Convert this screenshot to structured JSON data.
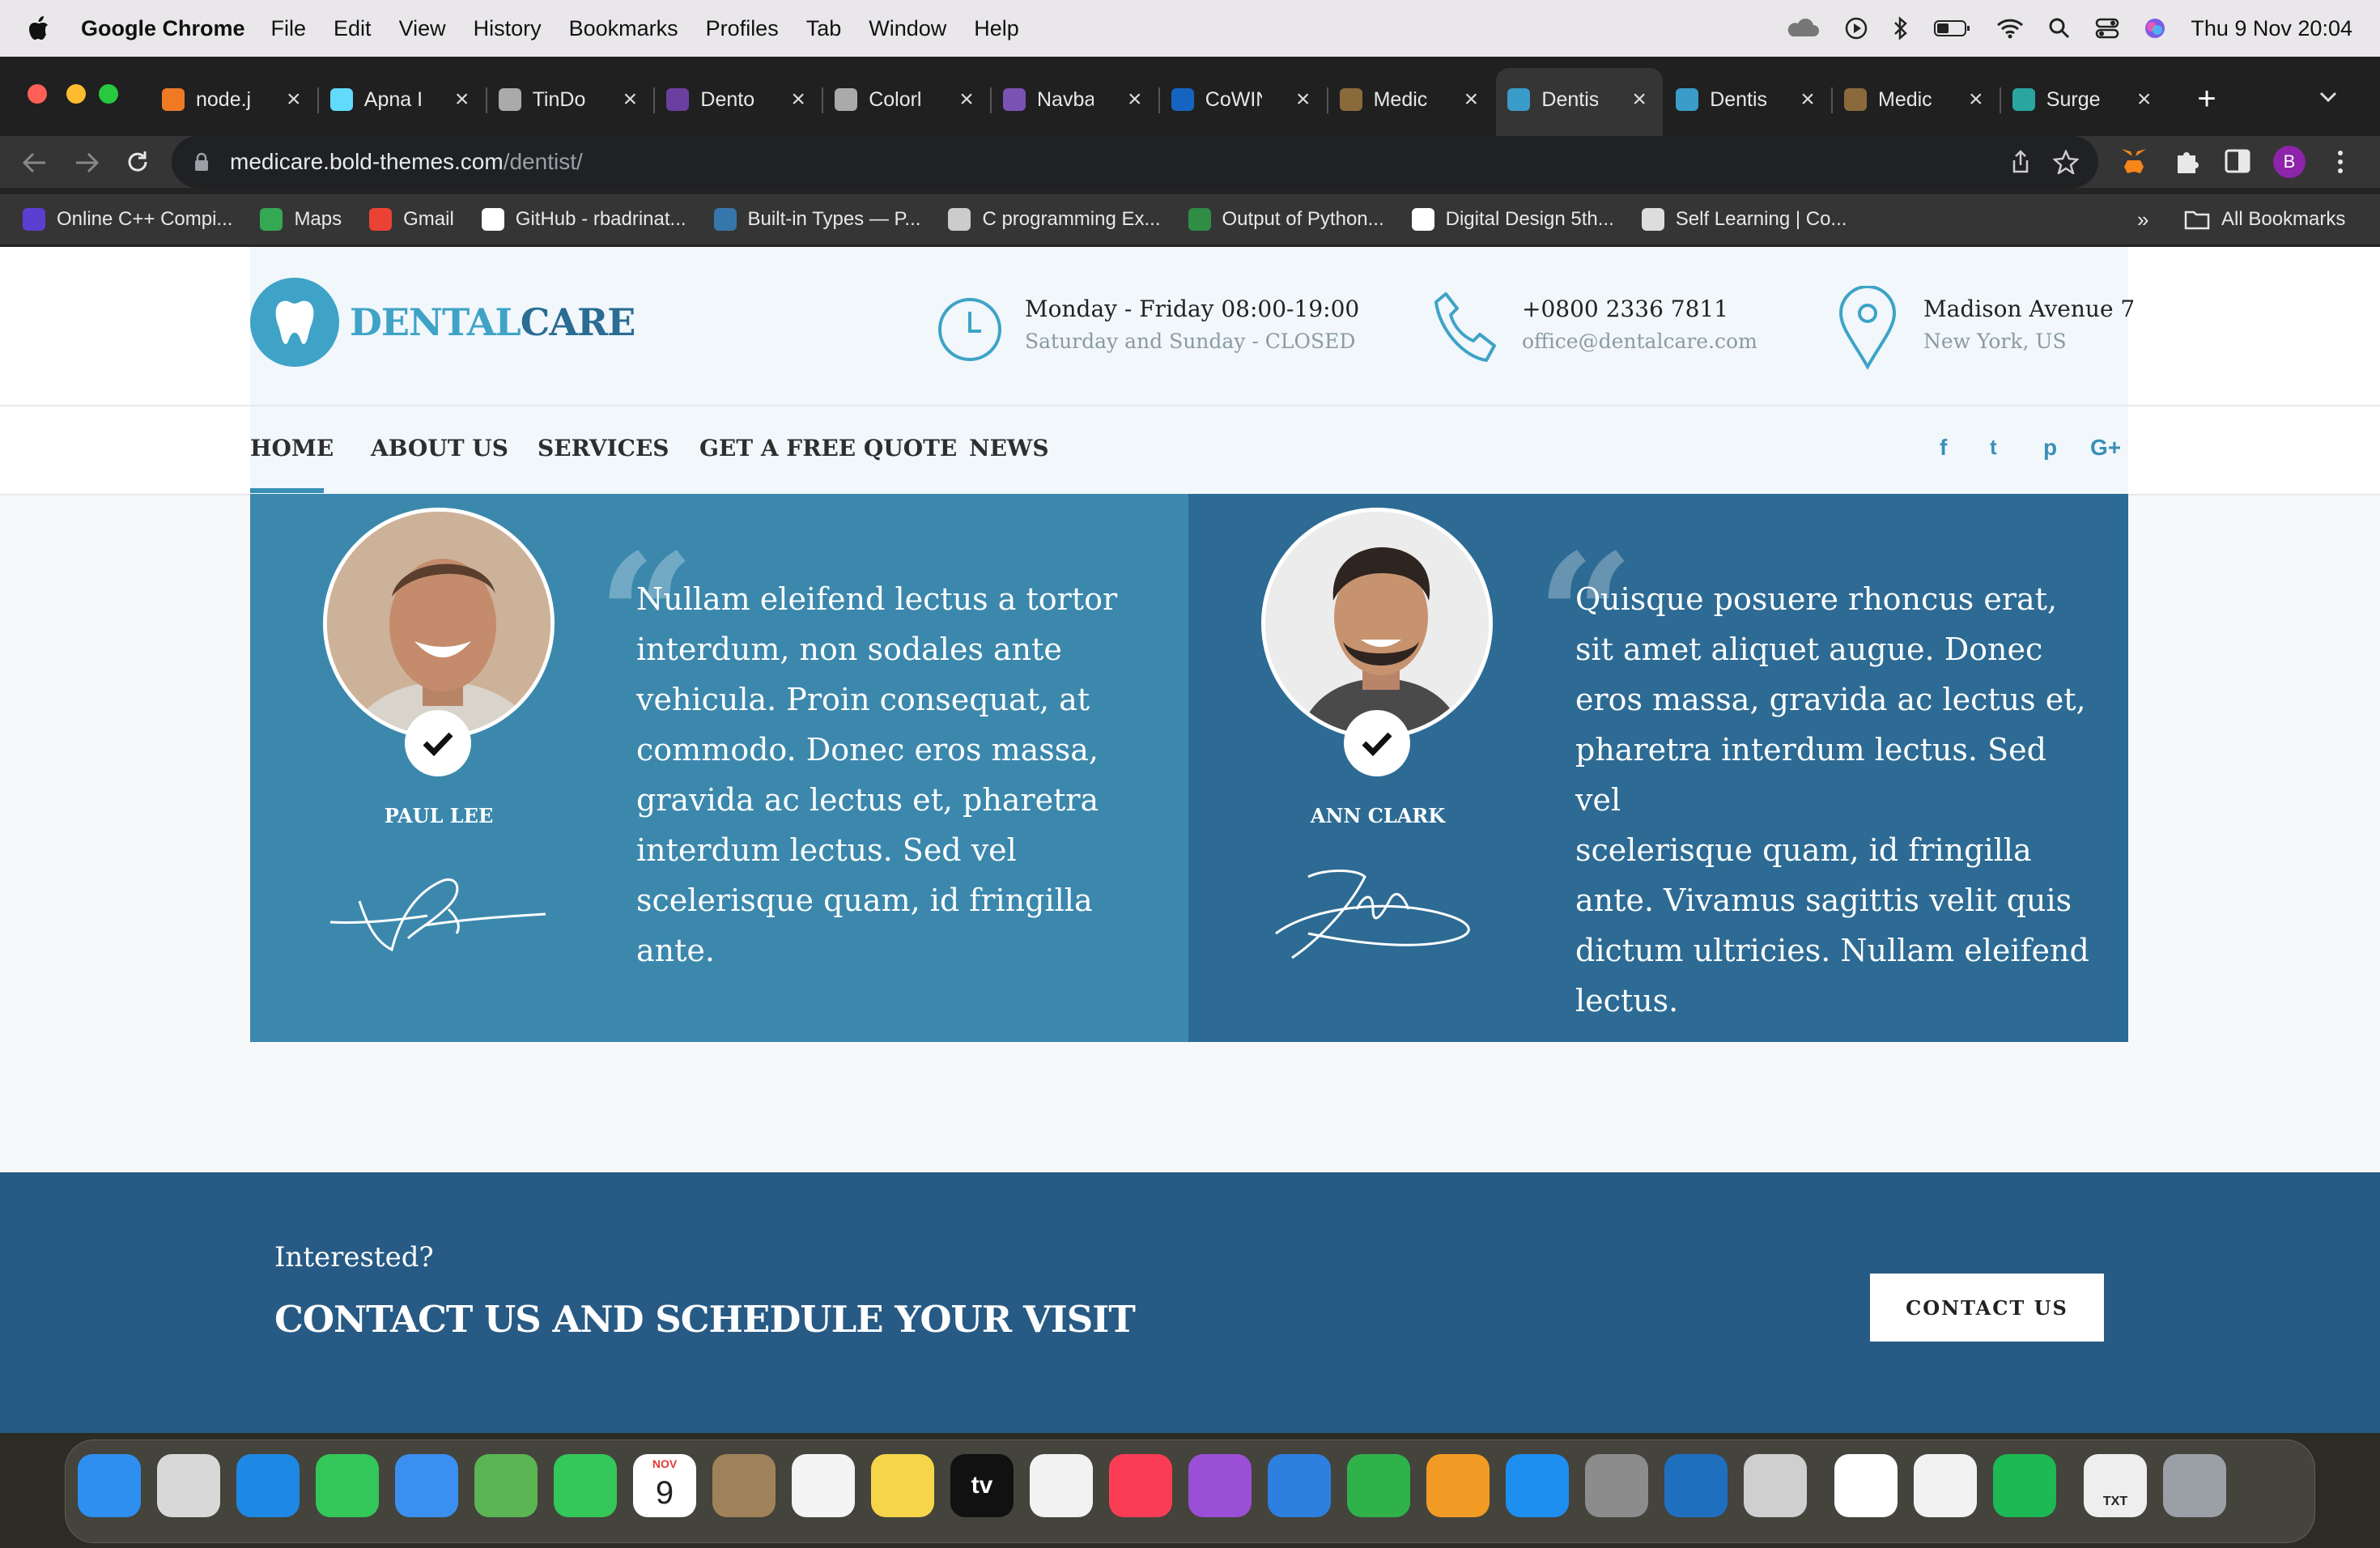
{
  "menubar": {
    "app": "Google Chrome",
    "items": [
      "File",
      "Edit",
      "View",
      "History",
      "Bookmarks",
      "Profiles",
      "Tab",
      "Window",
      "Help"
    ],
    "clock": "Thu 9 Nov  20:04"
  },
  "tabs": [
    {
      "label": "node.j",
      "color": "#f07a24"
    },
    {
      "label": "Apna I",
      "color": "#61dafb"
    },
    {
      "label": "TinDo",
      "color": "#aaaaaa"
    },
    {
      "label": "Dento",
      "color": "#6b3fa0"
    },
    {
      "label": "Colorl",
      "color": "#aaaaaa"
    },
    {
      "label": "Navba",
      "color": "#7952b3"
    },
    {
      "label": "CoWIN",
      "color": "#1565c0"
    },
    {
      "label": "Medic",
      "color": "#8a6a3a"
    },
    {
      "label": "Dentis",
      "color": "#3a9cc8"
    },
    {
      "label": "Dentis",
      "color": "#3a9cc8"
    },
    {
      "label": "Medic",
      "color": "#8a6a3a"
    },
    {
      "label": "Surge",
      "color": "#2aa6a0"
    }
  ],
  "omnibox": {
    "host": "medicare.bold-themes.com",
    "path": "/dentist/"
  },
  "bookmarks": [
    {
      "label": "Online C++ Compi...",
      "color": "#5b3fd0"
    },
    {
      "label": "Maps",
      "color": "#34a853"
    },
    {
      "label": "Gmail",
      "color": "#ea4335"
    },
    {
      "label": "GitHub - rbadrinat...",
      "color": "#ffffff"
    },
    {
      "label": "Built-in Types — P...",
      "color": "#3776ab"
    },
    {
      "label": "C programming Ex...",
      "color": "#cccccc"
    },
    {
      "label": "Output of Python...",
      "color": "#2f8d46"
    },
    {
      "label": "Digital Design 5th...",
      "color": "#ffffff"
    },
    {
      "label": "Self Learning | Co...",
      "color": "#dddddd"
    }
  ],
  "bookmarks_more": "»",
  "all_bookmarks": "All Bookmarks",
  "profile_initial": "B",
  "site": {
    "logo_prefix": "DENTAL",
    "logo_suffix": "CARE",
    "hours_main": "Monday - Friday 08:00-19:00",
    "hours_sub": "Saturday and Sunday - CLOSED",
    "phone_main": "+0800 2336 7811",
    "phone_sub": "office@dentalcare.com",
    "addr_main": "Madison Avenue 7",
    "addr_sub": "New York, US",
    "nav": [
      "HOME",
      "ABOUT US",
      "SERVICES",
      "GET A FREE QUOTE",
      "NEWS"
    ],
    "social": [
      "f",
      "t",
      "p",
      "G+"
    ]
  },
  "testimonials": [
    {
      "name": "PAUL LEE",
      "quote_lines": [
        "Nullam eleifend lectus a tortor",
        "interdum, non sodales ante",
        "vehicula. Proin consequat, at",
        "commodo. Donec eros massa,",
        "gravida ac lectus et, pharetra",
        "interdum lectus. Sed vel",
        "scelerisque quam, id fringilla",
        "ante."
      ]
    },
    {
      "name": "ANN CLARK",
      "quote_lines": [
        "Quisque posuere rhoncus erat,",
        "sit amet aliquet augue. Donec",
        "eros massa, gravida ac lectus et,",
        "pharetra interdum lectus. Sed vel",
        "scelerisque quam, id fringilla",
        "ante. Vivamus sagittis velit quis",
        "dictum ultricies. Nullam eleifend",
        "lectus."
      ]
    }
  ],
  "cta": {
    "kicker": "Interested?",
    "title": "CONTACT US AND SCHEDULE YOUR VISIT",
    "button": "CONTACT US"
  },
  "dock": [
    {
      "name": "Finder",
      "color": "#2f8ff0"
    },
    {
      "name": "Launchpad",
      "color": "#d8d8d8"
    },
    {
      "name": "Safari",
      "color": "#1e88e5"
    },
    {
      "name": "Messages",
      "color": "#34c759"
    },
    {
      "name": "Mail",
      "color": "#3b8ff0"
    },
    {
      "name": "Maps",
      "color": "#5ab552"
    },
    {
      "name": "FaceTime",
      "color": "#34c759"
    },
    {
      "name": "Calendar",
      "color": "#ffffff",
      "text": "9",
      "month": "NOV"
    },
    {
      "name": "Contacts",
      "color": "#a0825a"
    },
    {
      "name": "Reminders",
      "color": "#f4f4f4"
    },
    {
      "name": "Notes",
      "color": "#f7d54a"
    },
    {
      "name": "TV",
      "color": "#111111",
      "text": "tv"
    },
    {
      "name": "Photos",
      "color": "#f2f2f2"
    },
    {
      "name": "Music",
      "color": "#fa3d55"
    },
    {
      "name": "Podcasts",
      "color": "#9b4fd6"
    },
    {
      "name": "Keynote",
      "color": "#2d7fe0"
    },
    {
      "name": "Numbers",
      "color": "#30b24a"
    },
    {
      "name": "Pages",
      "color": "#f29b24"
    },
    {
      "name": "App Store",
      "color": "#1f8ef1"
    },
    {
      "name": "System Settings",
      "color": "#8c8c8c"
    },
    {
      "name": "VS Code",
      "color": "#1f6fbf"
    },
    {
      "name": "Preview",
      "color": "#cfcfcf"
    },
    {
      "name": "Chrome",
      "color": "#ffffff"
    },
    {
      "name": "TextEdit",
      "color": "#f2f2f2"
    },
    {
      "name": "Spotify",
      "color": "#1db954"
    },
    {
      "name": "Document",
      "color": "#eeeeee",
      "text": "TXT"
    },
    {
      "name": "Trash",
      "color": "#9aa0a6"
    }
  ]
}
